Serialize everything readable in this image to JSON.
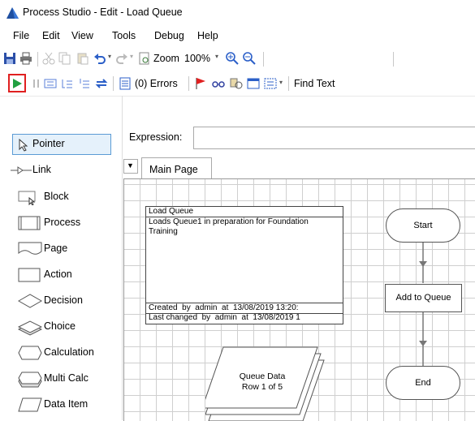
{
  "app": {
    "title": "Process Studio  - Edit - Load Queue"
  },
  "menu": [
    "File",
    "Edit",
    "View",
    "Tools",
    "Debug",
    "Help"
  ],
  "toolbar": {
    "zoom_label": "Zoom",
    "zoom_value": "100%"
  },
  "toolbar2": {
    "errors_label": "(0) Errors",
    "find_text": "Find Text"
  },
  "palette": [
    "Pointer",
    "Link",
    "Block",
    "Process",
    "Page",
    "Action",
    "Decision",
    "Choice",
    "Calculation",
    "Multi Calc",
    "Data Item"
  ],
  "expression": {
    "label": "Expression:",
    "value": ""
  },
  "tabs": [
    "Main Page"
  ],
  "info_box": {
    "title": "Load Queue",
    "description": "Loads Queue1 in preparation for Foundation Training",
    "created": "Created  by  admin  at  13/08/2019 13:20:",
    "changed": "Last changed  by  admin  at  13/08/2019 1"
  },
  "flow": {
    "start": "Start",
    "action": "Add to Queue",
    "end": "End"
  },
  "collection": {
    "name": "Queue Data",
    "rows": "Row 1 of 5"
  },
  "colors": {
    "accent_red": "#e02020",
    "run_green": "#20a040",
    "logo_blue": "#1f4fa0"
  }
}
